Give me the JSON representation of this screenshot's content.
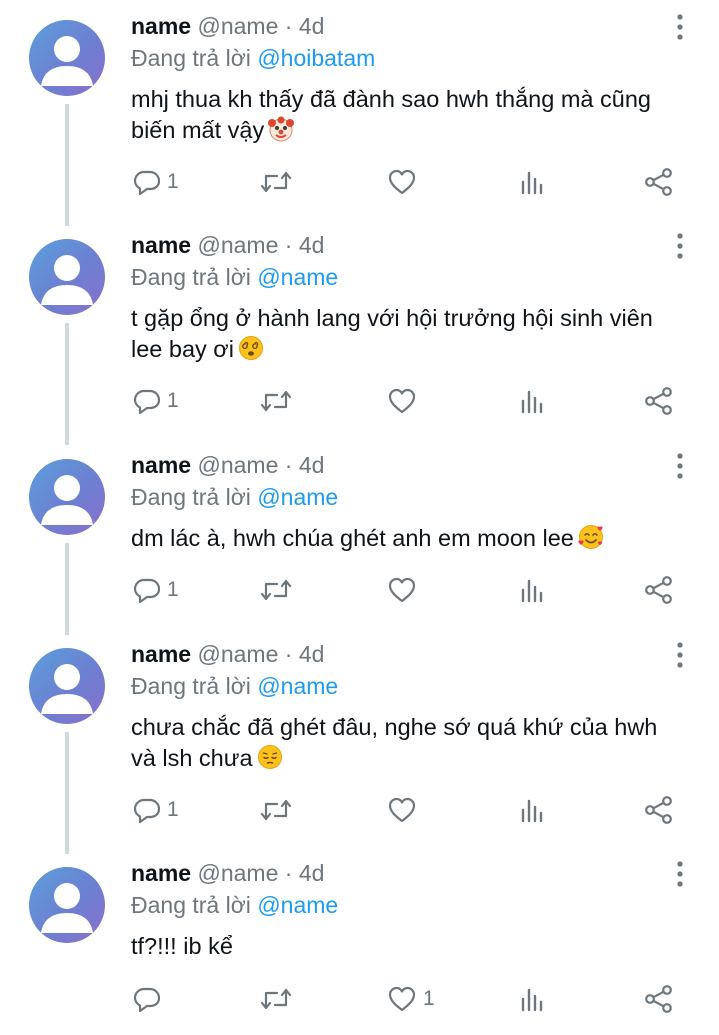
{
  "tweets": [
    {
      "name": "name",
      "handle": "@name",
      "separator": "·",
      "time": "4d",
      "reply_prefix": "Đang trả lời",
      "reply_to": "@hoibatam",
      "text": "mhj thua kh thấy đã đành sao hwh thắng mà cũng biến mất vậy",
      "emoji": "clown-face",
      "replies": "1",
      "retweets": "",
      "likes": ""
    },
    {
      "name": "name",
      "handle": "@name",
      "separator": "·",
      "time": "4d",
      "reply_prefix": "Đang trả lời",
      "reply_to": "@name",
      "text": "t gặp ổng ở hành lang với hội trưởng hội sinh viên lee bay ơi",
      "emoji": "dizzy-face",
      "replies": "1",
      "retweets": "",
      "likes": ""
    },
    {
      "name": "name",
      "handle": "@name",
      "separator": "·",
      "time": "4d",
      "reply_prefix": "Đang trả lời",
      "reply_to": "@name",
      "text": "dm lác à, hwh chúa ghét anh em moon lee",
      "emoji": "smiling-face-with-hearts",
      "replies": "1",
      "retweets": "",
      "likes": ""
    },
    {
      "name": "name",
      "handle": "@name",
      "separator": "·",
      "time": "4d",
      "reply_prefix": "Đang trả lời",
      "reply_to": "@name",
      "text": "chưa chắc đã ghét đâu, nghe sớ quá khứ của hwh và lsh chưa",
      "emoji": "pensive-face",
      "replies": "1",
      "retweets": "",
      "likes": ""
    },
    {
      "name": "name",
      "handle": "@name",
      "separator": "·",
      "time": "4d",
      "reply_prefix": "Đang trả lời",
      "reply_to": "@name",
      "text": "tf?!!! ib kể",
      "emoji": "",
      "replies": "",
      "retweets": "",
      "likes": "1"
    }
  ],
  "colors": {
    "text": "#0f1419",
    "secondary": "#6e767d",
    "mention": "#1d9bf0",
    "thread_line": "#cfd9de"
  },
  "icons": [
    "reply-icon",
    "retweet-icon",
    "like-icon",
    "analytics-icon",
    "share-icon",
    "more-options-icon",
    "avatar-placeholder-icon"
  ]
}
